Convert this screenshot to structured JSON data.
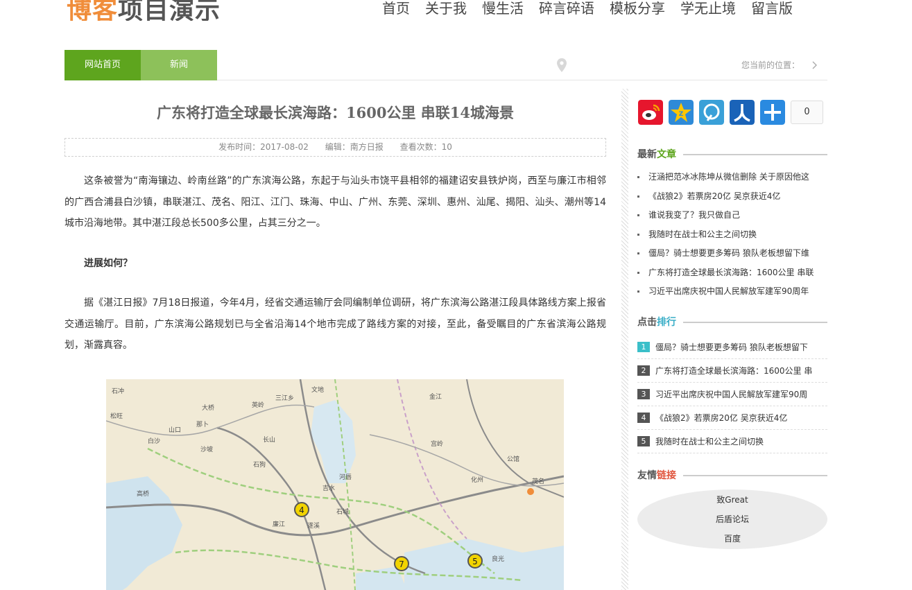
{
  "header": {
    "logo_part1": "博客",
    "logo_part2": "项目演示",
    "nav": [
      "首页",
      "关于我",
      "慢生活",
      "碎言碎语",
      "模板分享",
      "学无止境",
      "留言版"
    ]
  },
  "breadcrumb": {
    "home_tab": "网站首页",
    "news_tab": "新闻",
    "location_label": "您当前的位置："
  },
  "article": {
    "title": "广东将打造全球最长滨海路：1600公里 串联14城海景",
    "publish_time": "发布时间：2017-08-02",
    "editor": "编辑：南方日报",
    "views": "查看次数：10",
    "para1": "这条被誉为“南海镶边、岭南丝路”的广东滨海公路，东起于与汕头市饶平县相邻的福建诏安县铁炉岗，西至与廉江市相邻的广西合浦县白沙镇，串联湛江、茂名、阳江、江门、珠海、中山、广州、东莞、深圳、惠州、汕尾、揭阳、汕头、潮州等14城市沿海地带。其中湛江段总长500多公里，占其三分之一。",
    "subhead": "进展如何？",
    "para2": "据《湛江日报》7月18日报道，今年4月，经省交通运输厅会同编制单位调研，将广东滨海公路湛江段具体路线方案上报省交通运输厅。目前，广东滨海公路规划已与全省沿海14个地市完成了路线方案的对接，至此，备受瞩目的广东省滨海公路规划，渐露真容。",
    "map_labels": [
      "石冲",
      "松旺",
      "大桥",
      "那卜",
      "沙坡",
      "山口",
      "白沙",
      "高桥",
      "三江乡",
      "文地",
      "英岭",
      "长山",
      "石狗",
      "河唇",
      "吉水",
      "石城",
      "遂溪",
      "廉江",
      "化州",
      "茂名",
      "公馆",
      "良光",
      "宫岭",
      "金江"
    ]
  },
  "sidebar": {
    "share_count": "0",
    "latest_head_a": "最新",
    "latest_head_b": "文章",
    "latest": [
      "汪涵把范冰冰陈坤从微信删除 关于原因他这",
      "《战狼2》若票房20亿 吴京获近4亿",
      "谁说我变了？我只做自己",
      "我随时在战士和公主之间切换",
      "僵局？骑士想要更多筹码 狼队老板想留下维",
      "广东将打造全球最长滨海路：1600公里 串联",
      "习近平出席庆祝中国人民解放军建军90周年"
    ],
    "rank_head_a": "点击",
    "rank_head_b": "排行",
    "ranking": [
      {
        "num": "1",
        "title": "僵局？骑士想要更多筹码 狼队老板想留下"
      },
      {
        "num": "2",
        "title": "广东将打造全球最长滨海路：1600公里 串"
      },
      {
        "num": "3",
        "title": "习近平出席庆祝中国人民解放军建军90周"
      },
      {
        "num": "4",
        "title": "《战狼2》若票房20亿 吴京获近4亿"
      },
      {
        "num": "5",
        "title": "我随时在战士和公主之间切换"
      }
    ],
    "links_head_a": "友情",
    "links_head_b": "链接",
    "links": [
      "致Great",
      "后盾论坛",
      "百度"
    ]
  },
  "colors": {
    "green": "#5ea51e",
    "light_green": "#8dc15a",
    "teal": "#3aaec7",
    "red": "#e0553d",
    "orange": "#f08d3a"
  }
}
